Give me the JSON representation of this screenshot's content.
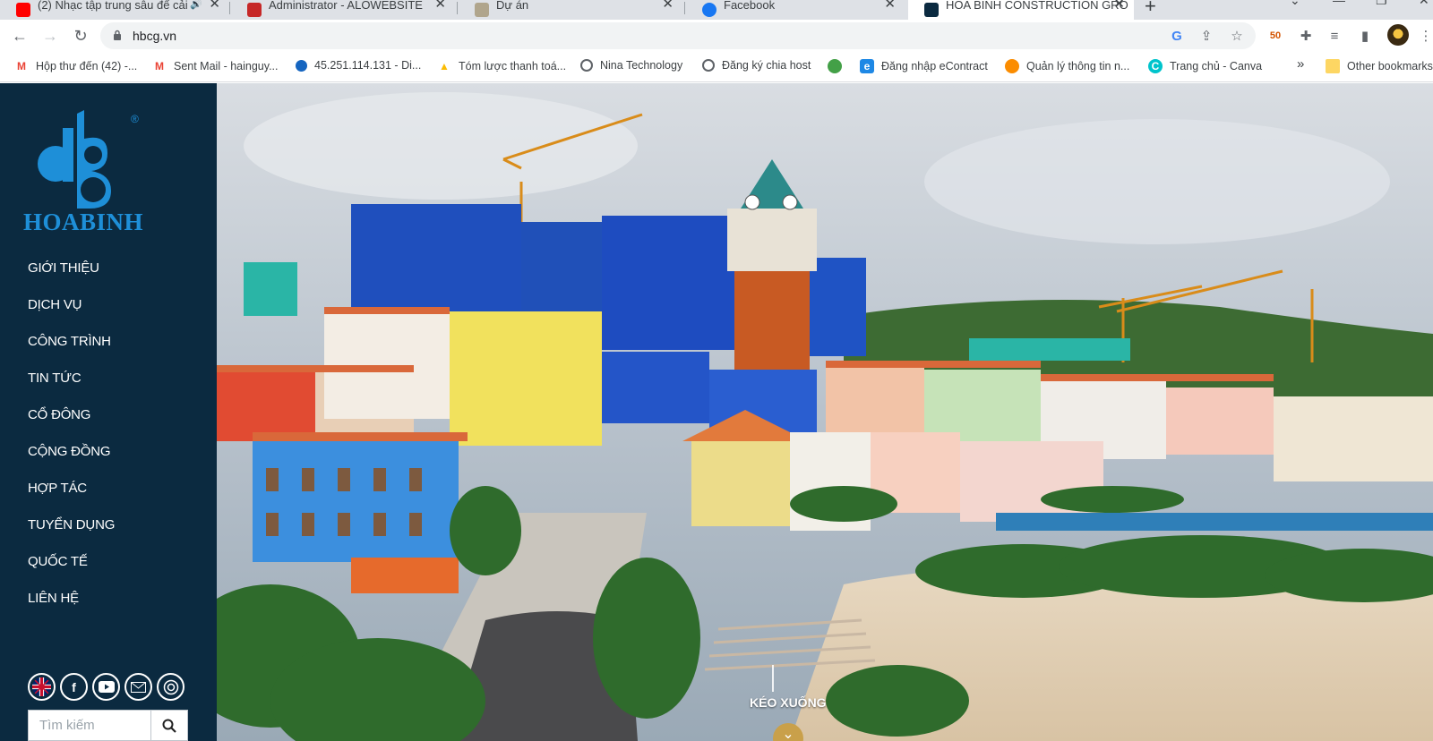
{
  "browser": {
    "tabs": [
      {
        "title": "(2) Nhạc tập trung sâu để cải",
        "active": false
      },
      {
        "title": "Administrator - ALOWEBSITE",
        "active": false
      },
      {
        "title": "Dự án",
        "active": false
      },
      {
        "title": "Facebook",
        "active": false
      },
      {
        "title": "HOA BINH CONSTRUCTION GRO",
        "active": true
      }
    ],
    "url": "hbcg.vn",
    "bookmarks": [
      "Hộp thư đến (42) -...",
      "Sent Mail - hainguy...",
      "45.251.114.131 - Di...",
      "Tóm lược thanh toá...",
      "Nina Technology",
      "Đăng ký chia host",
      "",
      "Đăng nhập eContract",
      "Quản lý thông tin n...",
      "Trang chủ - Canva"
    ],
    "more_bookmarks": "»",
    "other_bookmarks": "Other bookmarks",
    "extension_badge": "50"
  },
  "site": {
    "logo_text": "HOABINH",
    "registered_mark": "®",
    "nav": [
      "GIỚI THIỆU",
      "DỊCH VỤ",
      "CÔNG TRÌNH",
      "TIN TỨC",
      "CỔ ĐÔNG",
      "CỘNG ĐỒNG",
      "HỢP TÁC",
      "TUYỂN DỤNG",
      "QUỐC TẾ",
      "LIÊN HỆ"
    ],
    "social": [
      "uk-flag-icon",
      "facebook-icon",
      "youtube-icon",
      "mail-icon",
      "globe-icon"
    ],
    "search_placeholder": "Tìm kiếm",
    "scroll_label": "KÉO XUỐNG"
  },
  "colors": {
    "sidebar_bg": "#0b2a40",
    "logo_blue": "#1e8fd8",
    "accent_gold": "#c9a04a"
  }
}
